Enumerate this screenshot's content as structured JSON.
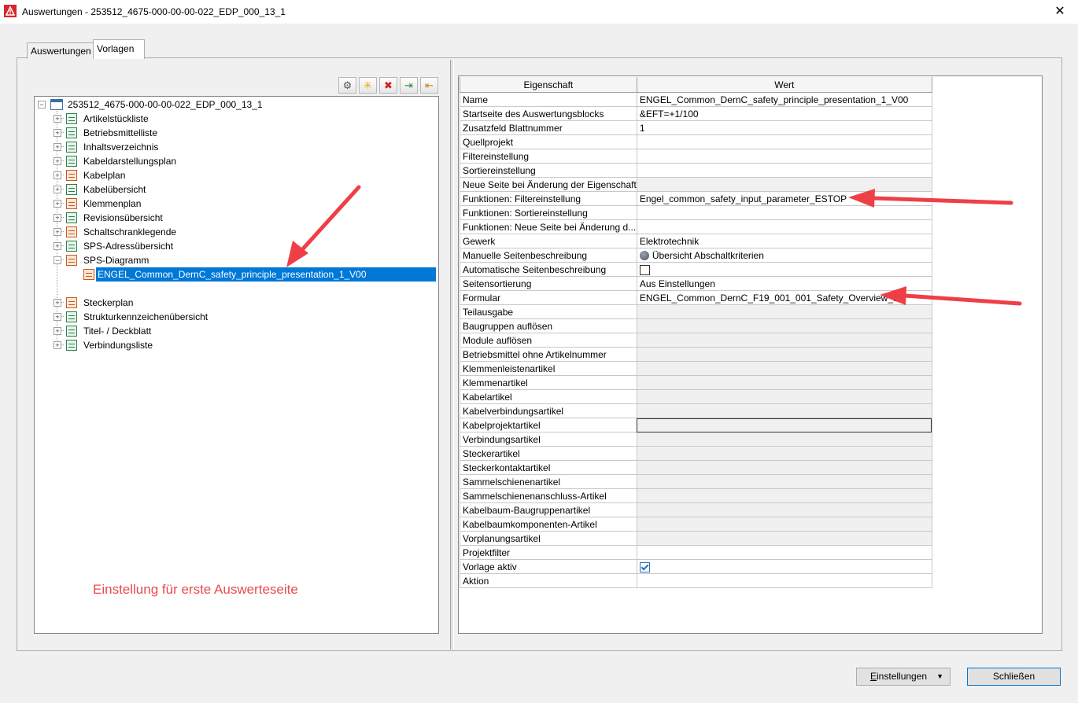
{
  "window": {
    "title": "Auswertungen - 253512_4675-000-00-00-022_EDP_000_13_1",
    "close_glyph": "✕"
  },
  "tabs": [
    {
      "label": "Auswertungen",
      "active": false
    },
    {
      "label": "Vorlagen",
      "active": true
    }
  ],
  "toolbar": {
    "icons": [
      "gear-icon",
      "new-icon",
      "delete-icon",
      "import-icon",
      "export-icon"
    ],
    "glyphs": [
      "⚙",
      "✳",
      "✖",
      "⇥",
      "⇤"
    ]
  },
  "tree": {
    "root": "253512_4675-000-00-00-022_EDP_000_13_1",
    "items": [
      {
        "label": "Artikelstückliste",
        "icon": "green"
      },
      {
        "label": "Betriebsmittelliste",
        "icon": "green"
      },
      {
        "label": "Inhaltsverzeichnis",
        "icon": "green"
      },
      {
        "label": "Kabeldarstellungsplan",
        "icon": "green"
      },
      {
        "label": "Kabelplan",
        "icon": "orange"
      },
      {
        "label": "Kabelübersicht",
        "icon": "green"
      },
      {
        "label": "Klemmenplan",
        "icon": "orange"
      },
      {
        "label": "Revisionsübersicht",
        "icon": "green"
      },
      {
        "label": "Schaltschranklegende",
        "icon": "orange"
      },
      {
        "label": "SPS-Adressübersicht",
        "icon": "green"
      },
      {
        "label": "SPS-Diagramm",
        "icon": "orange"
      },
      {
        "label": "ENGEL_Common_DernC_safety_principle_presentation_1_V00",
        "icon": "template"
      },
      {
        "label": "Steckerplan",
        "icon": "orange"
      },
      {
        "label": "Strukturkennzeichenübersicht",
        "icon": "green"
      },
      {
        "label": "Titel- / Deckblatt",
        "icon": "green"
      },
      {
        "label": "Verbindungsliste",
        "icon": "green"
      }
    ]
  },
  "annotation": "Einstellung für erste Auswerteseite",
  "grid": {
    "headers": {
      "property": "Eigenschaft",
      "value": "Wert"
    },
    "rows": [
      {
        "p": "Name",
        "v": "ENGEL_Common_DernC_safety_principle_presentation_1_V00",
        "kind": "text"
      },
      {
        "p": "Startseite des Auswertungsblocks",
        "v": "&EFT=+1/100",
        "kind": "text"
      },
      {
        "p": "Zusatzfeld Blattnummer",
        "v": "1",
        "kind": "text"
      },
      {
        "p": "Quellprojekt",
        "v": "",
        "kind": "text"
      },
      {
        "p": "Filtereinstellung",
        "v": "",
        "kind": "text"
      },
      {
        "p": "Sortiereinstellung",
        "v": "",
        "kind": "text"
      },
      {
        "p": "Neue Seite bei Änderung der Eigenschaft",
        "v": "",
        "kind": "disabled"
      },
      {
        "p": "Funktionen: Filtereinstellung",
        "v": "Engel_common_safety_input_parameter_ESTOP",
        "kind": "text"
      },
      {
        "p": "Funktionen: Sortiereinstellung",
        "v": "",
        "kind": "text"
      },
      {
        "p": "Funktionen: Neue Seite bei Änderung d...",
        "v": "",
        "kind": "text"
      },
      {
        "p": "Gewerk",
        "v": "Elektrotechnik",
        "kind": "text"
      },
      {
        "p": "Manuelle Seitenbeschreibung",
        "v": "Übersicht Abschaltkriterien",
        "kind": "globe"
      },
      {
        "p": "Automatische Seitenbeschreibung",
        "v": "",
        "kind": "checkbox-off"
      },
      {
        "p": "Seitensortierung",
        "v": "Aus Einstellungen",
        "kind": "text"
      },
      {
        "p": "Formular",
        "v": "ENGEL_Common_DernC_F19_001_001_Safety_Overview_1",
        "kind": "text"
      },
      {
        "p": "Teilausgabe",
        "v": "",
        "kind": "disabled"
      },
      {
        "p": "Baugruppen auflösen",
        "v": "",
        "kind": "disabled"
      },
      {
        "p": "Module auflösen",
        "v": "",
        "kind": "disabled"
      },
      {
        "p": "Betriebsmittel ohne Artikelnummer",
        "v": "",
        "kind": "disabled"
      },
      {
        "p": "Klemmenleistenartikel",
        "v": "",
        "kind": "disabled"
      },
      {
        "p": "Klemmenartikel",
        "v": "",
        "kind": "disabled"
      },
      {
        "p": "Kabelartikel",
        "v": "",
        "kind": "disabled"
      },
      {
        "p": "Kabelverbindungsartikel",
        "v": "",
        "kind": "disabled"
      },
      {
        "p": "Kabelprojektartikel",
        "v": "",
        "kind": "focus"
      },
      {
        "p": "Verbindungsartikel",
        "v": "",
        "kind": "disabled"
      },
      {
        "p": "Steckerartikel",
        "v": "",
        "kind": "disabled"
      },
      {
        "p": "Steckerkontaktartikel",
        "v": "",
        "kind": "disabled"
      },
      {
        "p": "Sammelschienenartikel",
        "v": "",
        "kind": "disabled"
      },
      {
        "p": "Sammelschienenanschluss-Artikel",
        "v": "",
        "kind": "disabled"
      },
      {
        "p": "Kabelbaum-Baugruppenartikel",
        "v": "",
        "kind": "disabled"
      },
      {
        "p": "Kabelbaumkomponenten-Artikel",
        "v": "",
        "kind": "disabled"
      },
      {
        "p": "Vorplanungsartikel",
        "v": "",
        "kind": "disabled"
      },
      {
        "p": "Projektfilter",
        "v": "",
        "kind": "text"
      },
      {
        "p": "Vorlage aktiv",
        "v": "",
        "kind": "checkbox-on"
      },
      {
        "p": "Aktion",
        "v": "",
        "kind": "text"
      }
    ]
  },
  "buttons": {
    "settings": {
      "accel": "E",
      "rest": "instellungen",
      "dropdown": "▼"
    },
    "close": "Schließen"
  },
  "colors": {
    "annotation": "#e84c4c",
    "selection": "#0078d7",
    "arrow": "#ef3f46"
  }
}
